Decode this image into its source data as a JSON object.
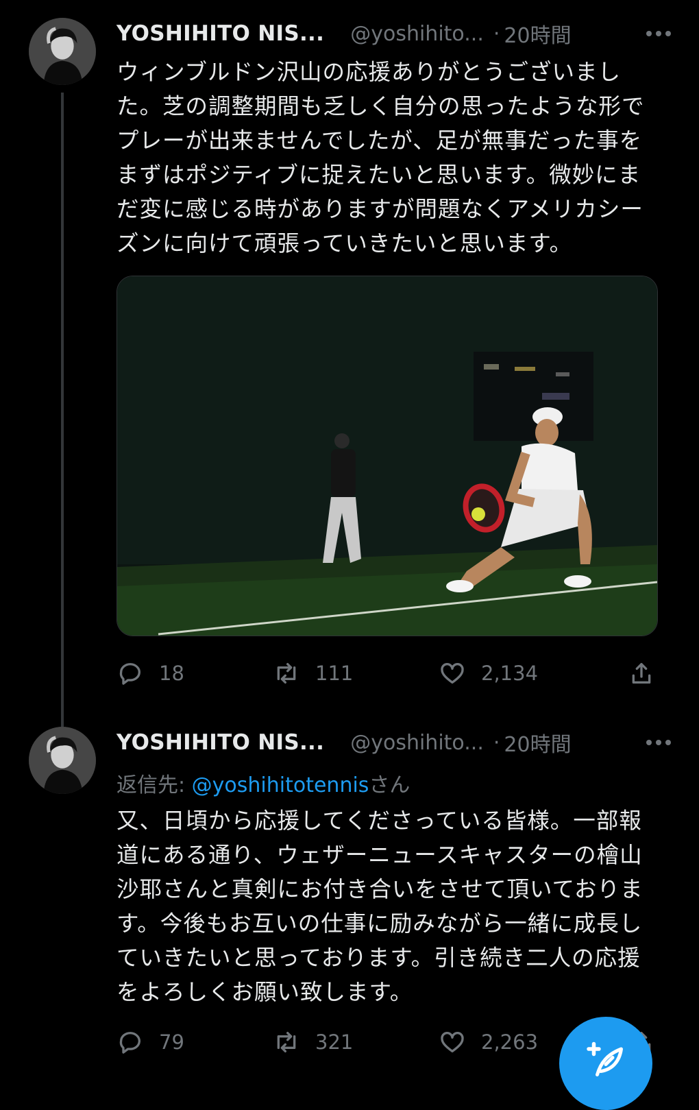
{
  "tweets": [
    {
      "author_name": "YOSHIHITO NIS...",
      "handle": "@yoshihito...",
      "separator": "·",
      "time": "20時間",
      "text_lines": [
        "ウィンブルドン沢山の応援ありがとうございまし",
        "た。芝の調整期間も乏しく自分の思ったような形で",
        "プレーが出来ませんでしたが、足が無事だった事を",
        "まずはポジティブに捉えたいと思います。微妙にま",
        "だ変に感じる時がありますが問題なくアメリカシー",
        "ズンに向けて頑張っていきたいと思います。"
      ],
      "replies": "18",
      "retweets": "111",
      "likes": "2,134"
    },
    {
      "author_name": "YOSHIHITO NIS...",
      "handle": "@yoshihito...",
      "separator": "·",
      "time": "20時間",
      "reply_prefix": "返信先: ",
      "reply_mention": "@yoshihitotennis",
      "reply_suffix": "さん",
      "text_lines": [
        "又、日頃から応援してくださっている皆様。一部報",
        "道にある通り、ウェザーニュースキャスターの檜山",
        "沙耶さんと真剣にお付き合いをさせて頂いておりま",
        "す。今後もお互いの仕事に励みながら一緒に成長し",
        "ていきたいと思っております。引き続き二人の応援",
        "をよろしくお願い致します。"
      ],
      "replies": "79",
      "retweets": "321",
      "likes": "2,263"
    }
  ],
  "icons": {
    "reply": "speech-bubble-icon",
    "retweet": "retweet-arrows-icon",
    "like": "heart-icon",
    "share": "share-upload-icon",
    "more": "more-dots-icon",
    "compose": "compose-feather-icon"
  },
  "colors": {
    "background": "#000000",
    "text": "#e7e9ea",
    "secondary": "#71767b",
    "accent": "#1d9bf0",
    "thread_line": "#333639"
  }
}
